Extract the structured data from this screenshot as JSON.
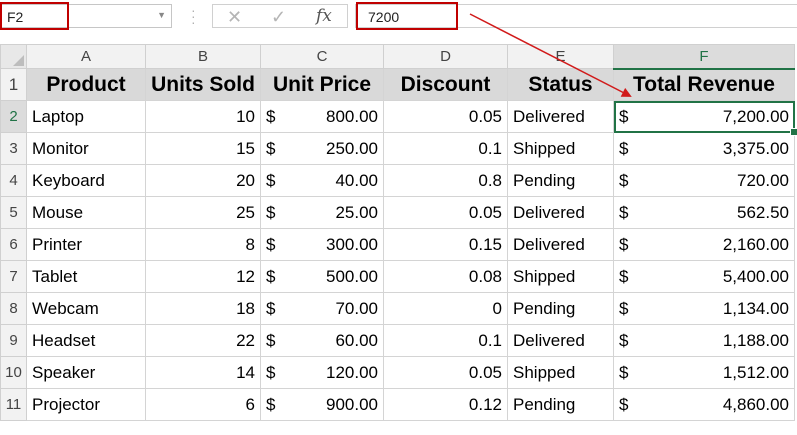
{
  "formula_bar": {
    "name_box": "F2",
    "cancel_icon": "✕",
    "enter_icon": "✓",
    "fx_label": "fx",
    "formula_value": "7200"
  },
  "columns": [
    "A",
    "B",
    "C",
    "D",
    "E",
    "F"
  ],
  "row_numbers": [
    "1",
    "2",
    "3",
    "4",
    "5",
    "6",
    "7",
    "8",
    "9",
    "10",
    "11"
  ],
  "headers": [
    "Product",
    "Units Sold",
    "Unit Price",
    "Discount",
    "Status",
    "Total Revenue"
  ],
  "currency_symbol": "$",
  "rows": [
    {
      "product": "Laptop",
      "units": "10",
      "price": "800.00",
      "discount": "0.05",
      "status": "Delivered",
      "revenue": "7,200.00"
    },
    {
      "product": "Monitor",
      "units": "15",
      "price": "250.00",
      "discount": "0.1",
      "status": "Shipped",
      "revenue": "3,375.00"
    },
    {
      "product": "Keyboard",
      "units": "20",
      "price": "40.00",
      "discount": "0.8",
      "status": "Pending",
      "revenue": "720.00"
    },
    {
      "product": "Mouse",
      "units": "25",
      "price": "25.00",
      "discount": "0.05",
      "status": "Delivered",
      "revenue": "562.50"
    },
    {
      "product": "Printer",
      "units": "8",
      "price": "300.00",
      "discount": "0.15",
      "status": "Delivered",
      "revenue": "2,160.00"
    },
    {
      "product": "Tablet",
      "units": "12",
      "price": "500.00",
      "discount": "0.08",
      "status": "Shipped",
      "revenue": "5,400.00"
    },
    {
      "product": "Webcam",
      "units": "18",
      "price": "70.00",
      "discount": "0",
      "status": "Pending",
      "revenue": "1,134.00"
    },
    {
      "product": "Headset",
      "units": "22",
      "price": "60.00",
      "discount": "0.1",
      "status": "Delivered",
      "revenue": "1,188.00"
    },
    {
      "product": "Speaker",
      "units": "14",
      "price": "120.00",
      "discount": "0.05",
      "status": "Shipped",
      "revenue": "1,512.00"
    },
    {
      "product": "Projector",
      "units": "6",
      "price": "900.00",
      "discount": "0.12",
      "status": "Pending",
      "revenue": "4,860.00"
    }
  ],
  "colors": {
    "annotation_red": "#c00000",
    "selection_green": "#217346",
    "header_fill": "#d9d9d9"
  }
}
